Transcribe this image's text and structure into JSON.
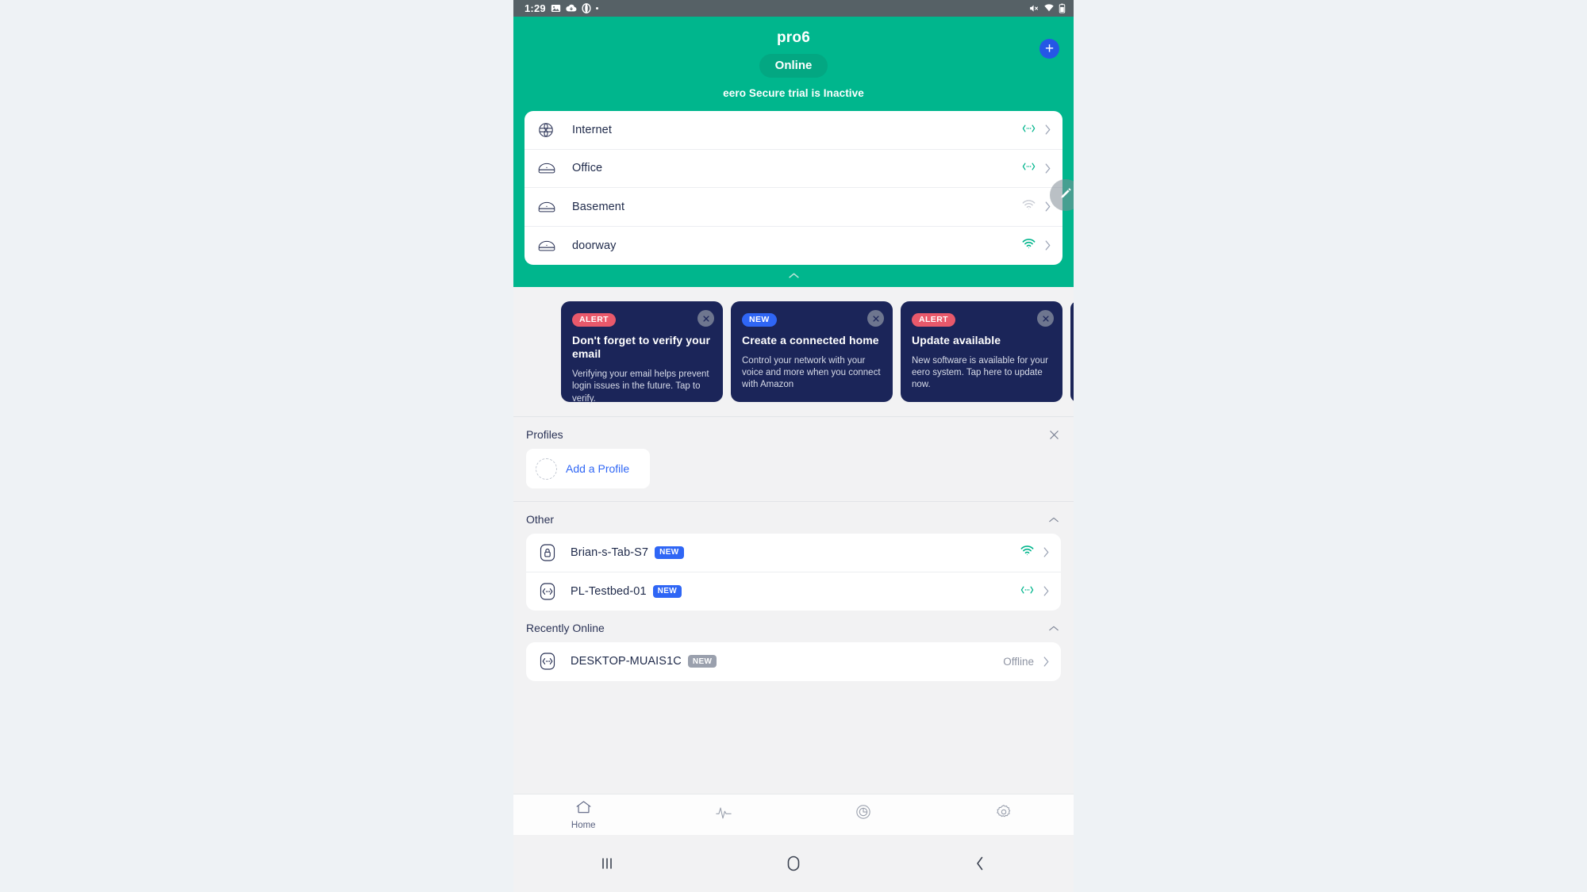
{
  "statusbar": {
    "time": "1:29",
    "left_icons": [
      "image-icon",
      "cloud-download-icon",
      "opera-o-icon",
      "dot-icon"
    ],
    "right_icons": [
      "volume-mute-icon",
      "wifi-icon",
      "battery-icon"
    ]
  },
  "header": {
    "network_name": "pro6",
    "status_label": "Online",
    "secure_notice": "eero Secure trial is Inactive",
    "add_button_label": "+",
    "accent_color": "#00b68d",
    "pill_color": "#03a782",
    "add_button_color": "#2557e6",
    "collapse_icon": "chevron-up-icon",
    "edit_fab_icon": "pencil-icon"
  },
  "devices": [
    {
      "name": "Internet",
      "icon": "globe-icon",
      "status_icon": "ethernet-icon",
      "status_state": "wired"
    },
    {
      "name": "Office",
      "icon": "eero-device-icon",
      "status_icon": "ethernet-icon",
      "status_state": "wired"
    },
    {
      "name": "Basement",
      "icon": "eero-device-icon",
      "status_icon": "wifi-icon",
      "status_state": "weak"
    },
    {
      "name": "doorway",
      "icon": "eero-device-icon",
      "status_icon": "wifi-icon",
      "status_state": "strong"
    }
  ],
  "cards": [
    {
      "badge": "ALERT",
      "badge_type": "alert",
      "title": "Don't forget to verify your email",
      "body": "Verifying your email helps prevent login issues in the future. Tap to verify.",
      "close_icon": "close-icon"
    },
    {
      "badge": "NEW",
      "badge_type": "new",
      "title": "Create a connected home",
      "body": "Control your network with your voice and more when you connect with Amazon",
      "close_icon": "close-icon"
    },
    {
      "badge": "ALERT",
      "badge_type": "alert",
      "title": "Update available",
      "body": "New software is available for your eero system. Tap here to update now.",
      "close_icon": "close-icon"
    }
  ],
  "profiles": {
    "title": "Profiles",
    "close_icon": "close-icon",
    "add_label": "Add a Profile"
  },
  "other": {
    "title": "Other",
    "collapse_icon": "chevron-up-icon",
    "rows": [
      {
        "name": "Brian-s-Tab-S7",
        "badge": "NEW",
        "badge_style": "blue",
        "icon": "lock-device-icon",
        "status_icon": "wifi-icon",
        "status_state": "strong",
        "status_text": ""
      },
      {
        "name": "PL-Testbed-01",
        "badge": "NEW",
        "badge_style": "blue",
        "icon": "generic-device-icon",
        "status_icon": "ethernet-icon",
        "status_state": "wired",
        "status_text": ""
      }
    ]
  },
  "recently_online": {
    "title": "Recently Online",
    "collapse_icon": "chevron-up-icon",
    "rows": [
      {
        "name": "DESKTOP-MUAIS1C",
        "badge": "NEW",
        "badge_style": "grey",
        "icon": "generic-device-icon",
        "status_icon": "",
        "status_state": "offline",
        "status_text": "Offline"
      }
    ]
  },
  "tabbar": {
    "items": [
      {
        "label": "Home",
        "icon": "home-icon",
        "active": true
      },
      {
        "label": "",
        "icon": "activity-pulse-icon",
        "active": false
      },
      {
        "label": "",
        "icon": "eero-logo-icon",
        "active": false
      },
      {
        "label": "",
        "icon": "gear-icon",
        "active": false
      }
    ]
  },
  "androidnav": {
    "recents_icon": "recents-icon",
    "home_icon": "home-circle-icon",
    "back_icon": "back-chevron-icon"
  }
}
